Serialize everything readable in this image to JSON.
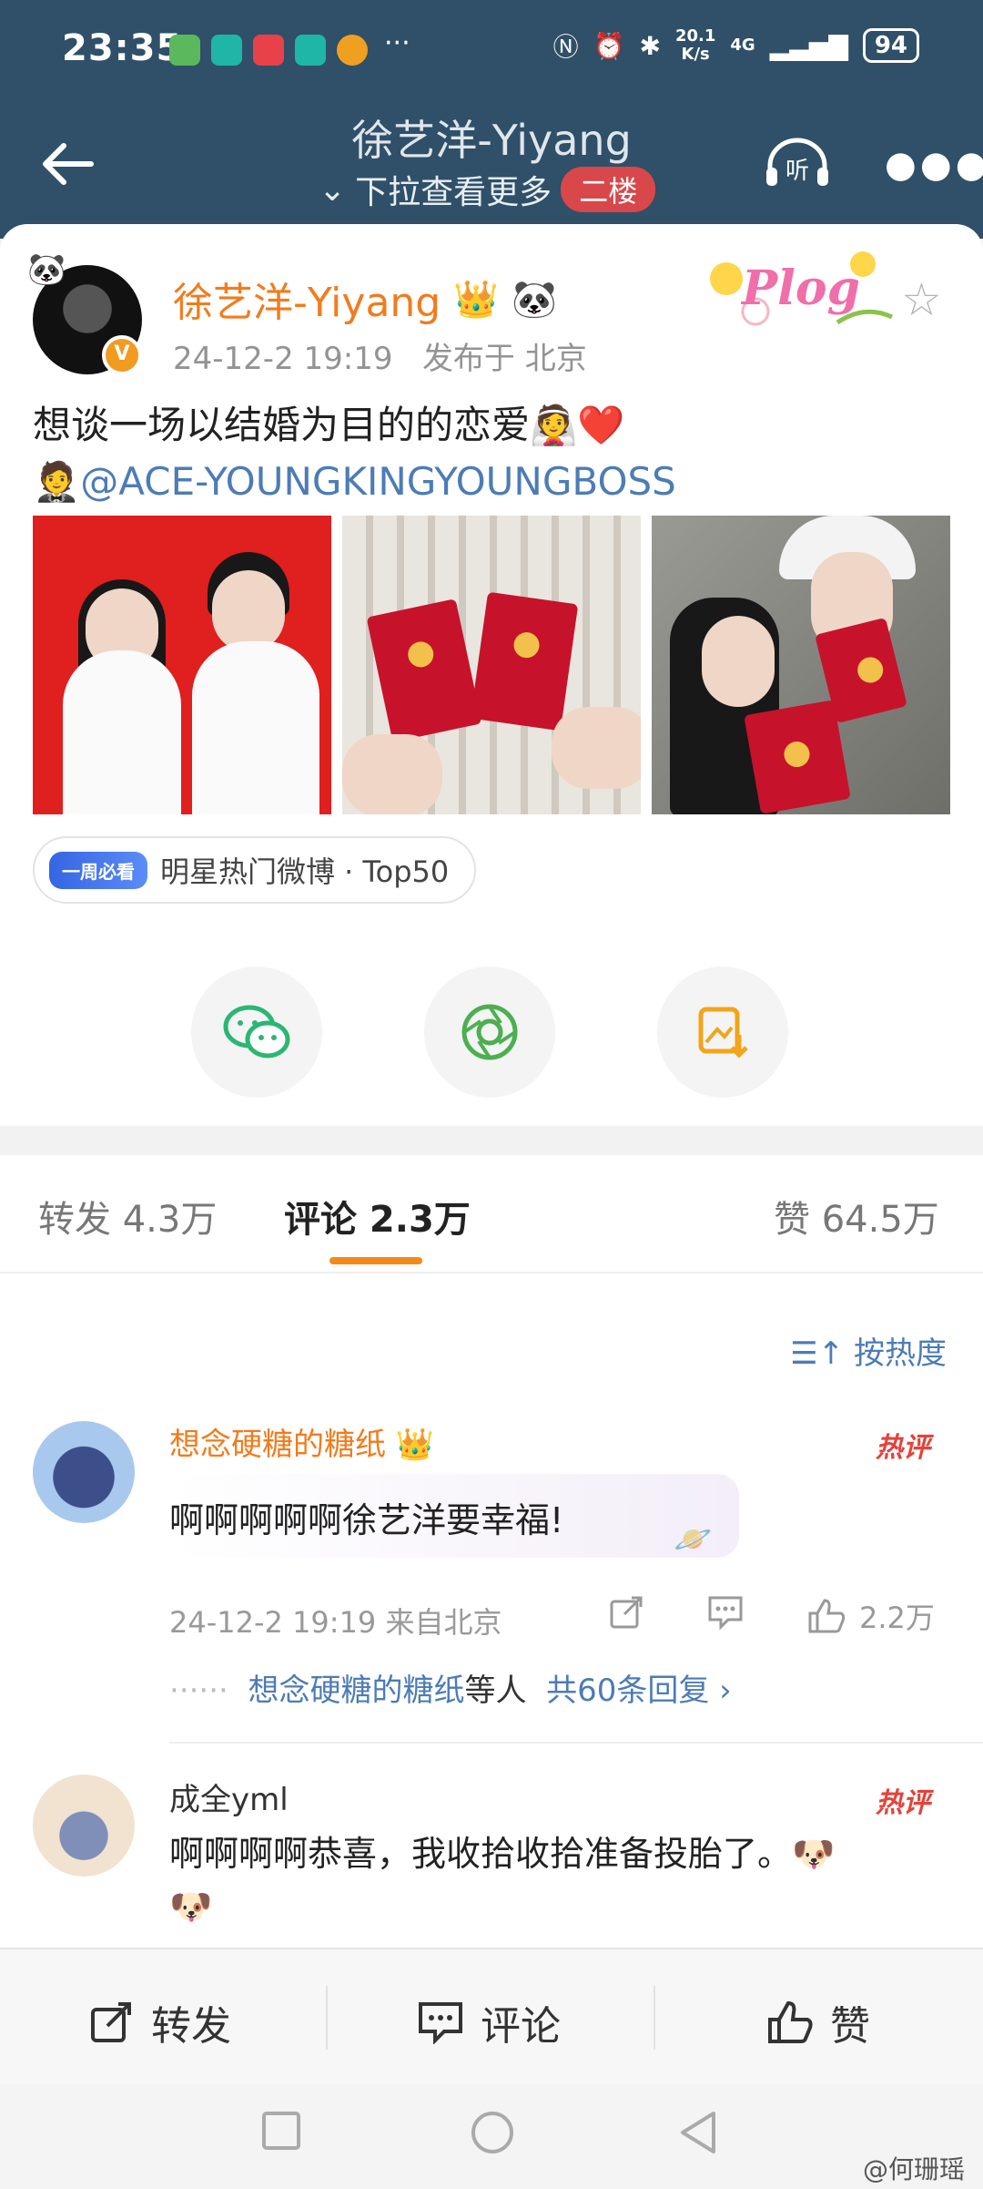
{
  "status_bar": {
    "time": "23:35",
    "more": "···",
    "net_speed_value": "20.1",
    "net_speed_unit": "K/s",
    "network": "4G",
    "battery": "94"
  },
  "header": {
    "title": "徐艺洋-Yiyang",
    "subtitle": "下拉查看更多",
    "floor_badge": "二楼",
    "listen_label": "听"
  },
  "post": {
    "author": "徐艺洋-Yiyang",
    "verify_mark": "V",
    "time": "24-12-2 19:19",
    "location": "发布于 北京",
    "plog_label": "Plog",
    "text_line1": "想谈一场以结婚为目的的恋爱",
    "text_line1_emoji": "👰❤️",
    "mention_emoji": "🤵",
    "mention": "@ACE-YOUNGKINGYOUNGBOSS",
    "hot_tag_pill": "一周必看",
    "hot_tag_text": "明星热门微博 · Top50"
  },
  "tabs": {
    "repost": "转发 4.3万",
    "comment": "评论 2.3万",
    "like": "赞 64.5万"
  },
  "comments": {
    "sort_label": "按热度",
    "items": [
      {
        "name": "想念硬糖的糖纸",
        "text": "啊啊啊啊啊徐艺洋要幸福!",
        "hot_label": "热评",
        "meta": "24-12-2 19:19 来自北京",
        "likes": "2.2万",
        "reply_dots": "······",
        "reply_name": "想念硬糖的糖纸",
        "reply_suffix": "等人",
        "reply_count": "共60条回复 ›"
      },
      {
        "name": "成全yml",
        "text": "啊啊啊啊恭喜，我收拾收拾准备投胎了。",
        "hot_label": "热评",
        "emoji": "🐶"
      }
    ]
  },
  "action_bar": {
    "repost": "转发",
    "comment": "评论",
    "like": "赞"
  },
  "watermark": "@何珊瑶",
  "colors": {
    "header_bg": "#2f5068",
    "author_orange": "#f27b1c",
    "link_blue": "#4d7cb5",
    "hot_red": "#e5423a",
    "tab_underline": "#f28a1a"
  }
}
